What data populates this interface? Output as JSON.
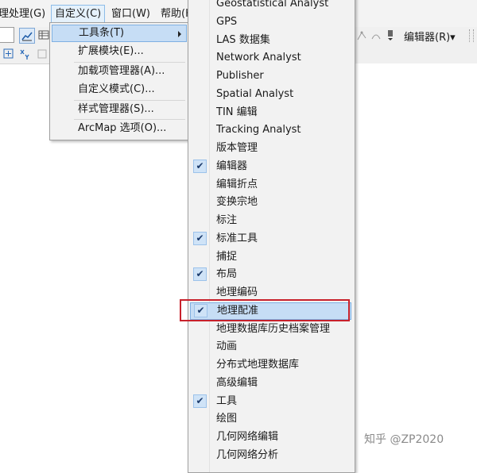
{
  "menubar": {
    "items": [
      {
        "label": "理处理(G)"
      },
      {
        "label": "自定义(C)"
      },
      {
        "label": "窗口(W)"
      },
      {
        "label": "帮助(H"
      }
    ]
  },
  "toolbar": {
    "editor_menu": "编辑器(R)▾"
  },
  "customize_menu": {
    "items": [
      {
        "label": "工具条(T)"
      },
      {
        "label": "扩展模块(E)..."
      },
      {
        "label": "加载项管理器(A)..."
      },
      {
        "label": "自定义模式(C)..."
      },
      {
        "label": "样式管理器(S)..."
      },
      {
        "label": "ArcMap 选项(O)..."
      }
    ]
  },
  "toolbars_submenu": {
    "check_glyph": "✔",
    "items": [
      {
        "label": "Geostatistical Analyst",
        "checked": false
      },
      {
        "label": "GPS",
        "checked": false
      },
      {
        "label": "LAS 数据集",
        "checked": false
      },
      {
        "label": "Network Analyst",
        "checked": false
      },
      {
        "label": "Publisher",
        "checked": false
      },
      {
        "label": "Spatial Analyst",
        "checked": false
      },
      {
        "label": "TIN 编辑",
        "checked": false
      },
      {
        "label": "Tracking Analyst",
        "checked": false
      },
      {
        "label": "版本管理",
        "checked": false
      },
      {
        "label": "编辑器",
        "checked": true
      },
      {
        "label": "编辑折点",
        "checked": false
      },
      {
        "label": "变换宗地",
        "checked": false
      },
      {
        "label": "标注",
        "checked": false
      },
      {
        "label": "标准工具",
        "checked": true
      },
      {
        "label": "捕捉",
        "checked": false
      },
      {
        "label": "布局",
        "checked": true
      },
      {
        "label": "地理编码",
        "checked": false
      },
      {
        "label": "地理配准",
        "checked": true
      },
      {
        "label": "地理数据库历史档案管理",
        "checked": false
      },
      {
        "label": "动画",
        "checked": false
      },
      {
        "label": "分布式地理数据库",
        "checked": false
      },
      {
        "label": "高级编辑",
        "checked": false
      },
      {
        "label": "工具",
        "checked": true
      },
      {
        "label": "绘图",
        "checked": false
      },
      {
        "label": "几何网络编辑",
        "checked": false
      },
      {
        "label": "几何网络分析",
        "checked": false
      }
    ]
  },
  "watermark": "知乎 @ZP2020",
  "colors": {
    "highlight": "#c6ddf5",
    "annotation_box": "#c8212b"
  }
}
